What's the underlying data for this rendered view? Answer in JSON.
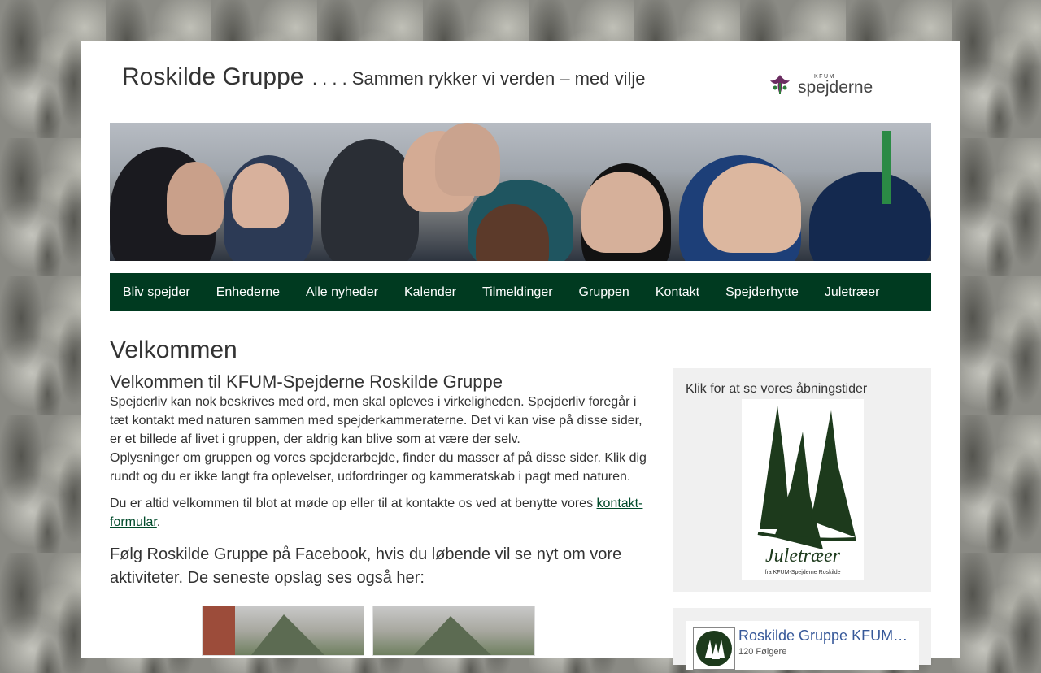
{
  "header": {
    "site_title": "Roskilde Gruppe",
    "tagline": ". . . . Sammen rykker vi verden – med vilje",
    "logo_small": "KFUM",
    "logo_main": "spejderne"
  },
  "nav": {
    "items": [
      {
        "label": "Bliv spejder"
      },
      {
        "label": "Enhederne"
      },
      {
        "label": "Alle nyheder"
      },
      {
        "label": "Kalender"
      },
      {
        "label": "Tilmeldinger"
      },
      {
        "label": "Gruppen"
      },
      {
        "label": "Kontakt"
      },
      {
        "label": "Spejderhytte"
      },
      {
        "label": "Juletræer"
      }
    ]
  },
  "main": {
    "heading": "Velkommen",
    "subheading": "Velkommen til KFUM-Spejderne Roskilde Gruppe",
    "para1": "Spejderliv kan nok beskrives med ord, men skal opleves i virkeligheden. Spejderliv foregår i tæt kontakt med naturen sammen med spejderkammeraterne. Det vi kan vise på disse sider, er et billede af livet i gruppen, der aldrig kan blive som at være der selv.",
    "para2": "Oplysninger om gruppen og vores spejderarbejde, finder du masser af på disse sider. Klik dig rundt og du er ikke langt fra oplevelser, udfordringer og kammeratskab i pagt med naturen.",
    "para3_before": "Du er altid velkommen til blot at møde op eller til at kontakte os ved at benytte vores ",
    "para3_link": "kontakt-formular",
    "para3_after": ".",
    "facebook_text": "Følg Roskilde Gruppe på Facebook, hvis du løbende vil se nyt om vore aktiviteter. De seneste opslag ses også her:"
  },
  "sidebar": {
    "hours_text": "Klik for at se vores åbningstider",
    "jul_title": "Juletræer",
    "jul_subtitle": "fra KFUM-Spejderne Roskilde"
  },
  "facebook_widget": {
    "page_name": "Roskilde Gruppe KFUM-Spejderne",
    "followers": "120 Følgere"
  },
  "colors": {
    "nav_bg": "#003a20",
    "link": "#004a2a",
    "fb_blue": "#365899",
    "tree_green": "#1d3a1c"
  }
}
